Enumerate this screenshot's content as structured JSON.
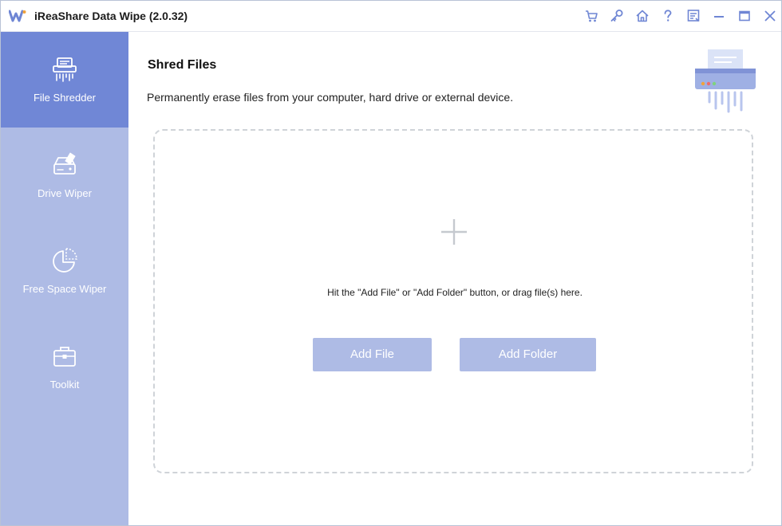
{
  "window": {
    "title": "iReaShare Data Wipe (2.0.32)"
  },
  "toolbar_icons": [
    "cart-icon",
    "key-icon",
    "home-icon",
    "help-icon",
    "feedback-icon",
    "minimize-icon",
    "maximize-icon",
    "close-icon"
  ],
  "sidebar": {
    "items": [
      {
        "label": "File Shredder",
        "icon": "shredder-icon",
        "active": true
      },
      {
        "label": "Drive Wiper",
        "icon": "drive-eraser-icon",
        "active": false
      },
      {
        "label": "Free Space Wiper",
        "icon": "pie-chart-icon",
        "active": false
      },
      {
        "label": "Toolkit",
        "icon": "toolbox-icon",
        "active": false
      }
    ]
  },
  "main": {
    "title": "Shred Files",
    "description": "Permanently erase files from your computer, hard drive or external device.",
    "dropzone": {
      "hint": "Hit the \"Add File\" or \"Add Folder\" button, or drag file(s) here."
    },
    "add_file_label": "Add File",
    "add_folder_label": "Add Folder"
  },
  "colors": {
    "sidebar_bg": "#aebbe5",
    "sidebar_active": "#7087d6",
    "button_bg": "#aebbe5",
    "icon_accent": "#6f86d4"
  }
}
